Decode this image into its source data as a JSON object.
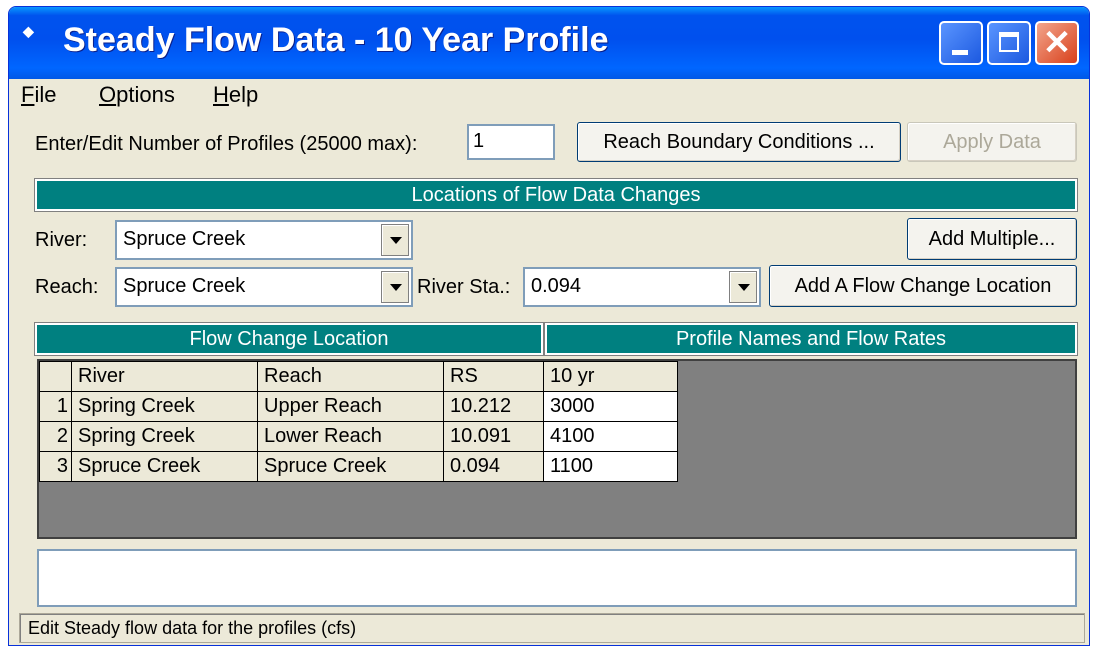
{
  "window": {
    "title": "Steady Flow Data - 10 Year Profile",
    "close_glyph": "✕"
  },
  "menu": [
    {
      "accel": "F",
      "rest": "ile"
    },
    {
      "accel": "O",
      "rest": "ptions"
    },
    {
      "accel": "H",
      "rest": "elp"
    }
  ],
  "profiles": {
    "label": "Enter/Edit Number of Profiles (25000 max):",
    "value": "1"
  },
  "buttons": {
    "reach_boundary": "Reach Boundary Conditions ...",
    "apply_data": "Apply Data",
    "add_multiple": "Add Multiple...",
    "add_flow_change": "Add A Flow Change Location"
  },
  "locations": {
    "header": "Locations of Flow Data Changes",
    "river_label": "River:",
    "river_value": "Spruce Creek",
    "reach_label": "Reach:",
    "reach_value": "Spruce Creek",
    "station_label": "River Sta.:",
    "station_value": "0.094"
  },
  "table": {
    "left_header": "Flow Change Location",
    "right_header": "Profile Names and Flow Rates",
    "columns": [
      "River",
      "Reach",
      "RS",
      "10 yr"
    ],
    "rows": [
      {
        "num": "1",
        "river": "Spring Creek",
        "reach": "Upper Reach",
        "rs": "10.212",
        "flow": "3000"
      },
      {
        "num": "2",
        "river": "Spring Creek",
        "reach": "Lower Reach",
        "rs": "10.091",
        "flow": "4100"
      },
      {
        "num": "3",
        "river": "Spruce Creek",
        "reach": "Spruce Creek",
        "rs": "0.094",
        "flow": "1100"
      }
    ]
  },
  "status": "Edit Steady flow data for the profiles (cfs)"
}
